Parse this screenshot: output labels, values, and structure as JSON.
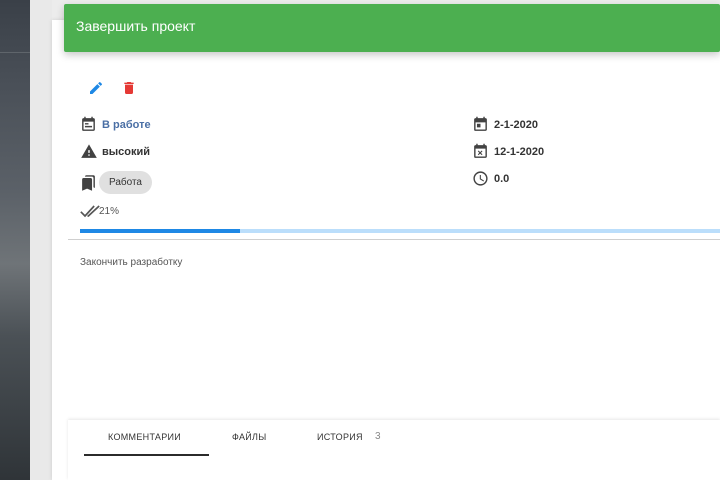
{
  "header": {
    "title": "Завершить проект",
    "color": "#4caf50"
  },
  "actions": {
    "edit_icon": "pencil-icon",
    "delete_icon": "trash-icon",
    "edit_color": "#1e88e5",
    "delete_color": "#e53935"
  },
  "details": {
    "status": "В работе",
    "priority": "высокий",
    "tag": "Работа",
    "progress_label": "21%",
    "progress_value": 0.21,
    "start_date": "2-1-2020",
    "due_date": "12-1-2020",
    "time_spent": "0.0"
  },
  "description": "Закончить разработку",
  "tabs": {
    "comments": "КОММЕНТАРИИ",
    "files": "ФАЙЛЫ",
    "history": "ИСТОРИЯ",
    "history_count": "3"
  }
}
